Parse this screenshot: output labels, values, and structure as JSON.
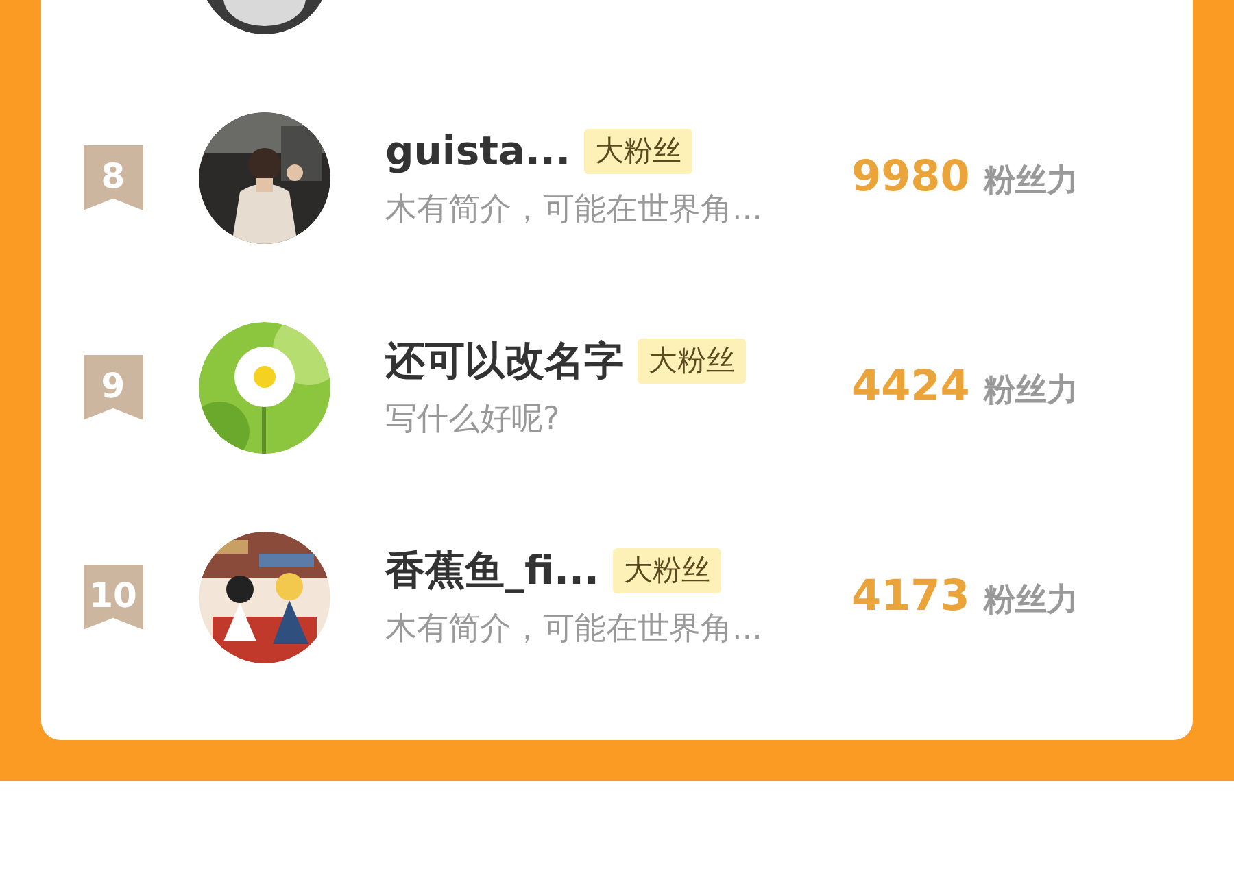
{
  "ranking": [
    {
      "rank": "8",
      "name": "guista...",
      "tag": "大粉丝",
      "bio": "木有简介，可能在世界角...",
      "score": "9980",
      "unit": "粉丝力"
    },
    {
      "rank": "9",
      "name": "还可以改名字",
      "tag": "大粉丝",
      "bio": "写什么好呢?",
      "score": "4424",
      "unit": "粉丝力"
    },
    {
      "rank": "10",
      "name": "香蕉鱼_fi...",
      "tag": "大粉丝",
      "bio": "木有简介，可能在世界角...",
      "score": "4173",
      "unit": "粉丝力"
    }
  ]
}
